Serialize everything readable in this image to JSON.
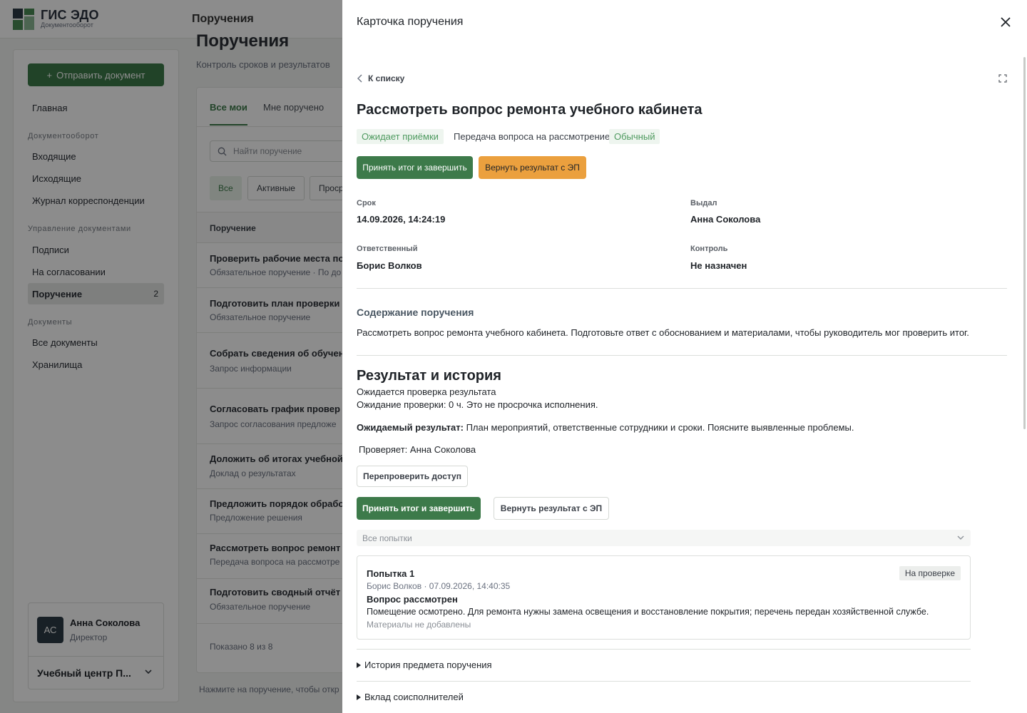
{
  "app": {
    "brand_title": "ГИС ЭДО",
    "brand_sub": "Документооборот",
    "topbar_title": "Поручения",
    "colors": {
      "accent": "#3d7a4a",
      "warning": "#eba03e",
      "badge_green": "#4e9a5f"
    }
  },
  "sidebar": {
    "send_label": "Отправить документ",
    "home": "Главная",
    "groups": [
      {
        "label": "Документооборот",
        "items": [
          "Входящие",
          "Исходящие",
          "Журнал корреспонденции"
        ]
      },
      {
        "label": "Управление документами",
        "items": [
          "Подписи",
          "На согласовании",
          "Поручение"
        ]
      },
      {
        "label": "Документы",
        "items": [
          "Все документы",
          "Хранилища"
        ]
      }
    ],
    "active_count": "2",
    "user": {
      "initials": "АС",
      "name": "Анна Соколова",
      "role": "Директор",
      "org": "Учебный центр П..."
    }
  },
  "main": {
    "title": "Поручения",
    "subtitle": "Контроль сроков и результатов",
    "tabs": [
      "Все мои",
      "Мне поручено"
    ],
    "search_placeholder": "Найти поручение",
    "chips": [
      "Все",
      "Активные",
      "Проср"
    ],
    "column": "Поручение",
    "rows": [
      {
        "title": "Проверить рабочие места по",
        "sub": "Обязательное поручение · По до"
      },
      {
        "title": "Подготовить план проверки",
        "sub": "Обязательное поручение"
      },
      {
        "title": "Собрать сведения об обучен",
        "sub": "Запрос информации"
      },
      {
        "title": "Согласовать график провер",
        "sub": "Запрос согласования предложе"
      },
      {
        "title": "Доложить об итогах учебной",
        "sub": "Доклад о результатах"
      },
      {
        "title": "Предложить порядок обрабо",
        "sub": "Предложение решения"
      },
      {
        "title": "Рассмотреть вопрос ремонт",
        "sub": "Передача вопроса на рассмотре"
      },
      {
        "title": "Подготовить сводный отчёт",
        "sub": "Обязательное поручение"
      }
    ],
    "shown": "Показано 8 из 8",
    "hint": "Нажмите на поручение, чтобы откр"
  },
  "drawer": {
    "title": "Карточка поручения",
    "back_label": "К списку",
    "card_title": "Рассмотреть вопрос ремонта учебного кабинета",
    "badges": {
      "status": "Ожидает приёмки",
      "type": "Передача вопроса на рассмотрение",
      "priority": "Обычный"
    },
    "actions": {
      "accept": "Принять итог и завершить",
      "return": "Вернуть результат с ЭП"
    },
    "fields": {
      "deadline_label": "Срок",
      "deadline": "14.09.2026, 14:24:19",
      "issued_label": "Выдал",
      "issued": "Анна Соколова",
      "responsible_label": "Ответственный",
      "responsible": "Борис Волков",
      "control_label": "Контроль",
      "control": "Не назначен"
    },
    "content_heading": "Содержание поручения",
    "content_text": "Рассмотреть вопрос ремонта учебного кабинета. Подготовьте ответ с обоснованием и материалами, чтобы руководитель мог проверить итог.",
    "result_heading": "Результат и история",
    "result_status": "Ожидается проверка результата",
    "result_wait": "Ожидание проверки: 0 ч. Это не просрочка исполнения.",
    "expected_label": "Ожидаемый результат:",
    "expected_text": " План мероприятий, ответственные сотрудники и сроки. Поясните выявленные проблемы.",
    "reviewer": "Проверяет: Анна Соколова",
    "recheck": "Перепроверить доступ",
    "attempts_select": "Все попытки",
    "attempt": {
      "title": "Попытка 1",
      "status": "На проверке",
      "meta": "Борис Волков · 07.09.2026, 14:40:35",
      "heading": "Вопрос рассмотрен",
      "text": "Помещение осмотрено. Для ремонта нужны замена освещения и восстановление покрытия; перечень передан хозяйственной службе.",
      "files": "Материалы не добавлены"
    },
    "details": [
      "История предмета поручения",
      "Вклад соисполнителей"
    ]
  }
}
